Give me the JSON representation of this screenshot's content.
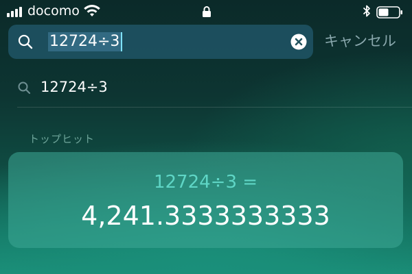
{
  "status_bar": {
    "carrier": "docomo",
    "signal_bars": 4,
    "icons": [
      "signal-icon",
      "wifi-icon",
      "lock-icon",
      "bluetooth-icon",
      "battery-icon"
    ],
    "battery_level": 0.5
  },
  "search": {
    "query": "12724÷3",
    "clear_icon": "clear-icon",
    "cancel_label": "キャンセル"
  },
  "suggestion": {
    "text": "12724÷3",
    "icon": "search-icon"
  },
  "top_hit": {
    "section_label": "トップヒット",
    "expression": "12724÷3 =",
    "result": "4,241.3333333333"
  },
  "colors": {
    "accent_teal": "#5fd6c6",
    "cancel_text": "#8aa8ad",
    "section_label": "#6ea59a",
    "caret": "#7fe3ff"
  }
}
